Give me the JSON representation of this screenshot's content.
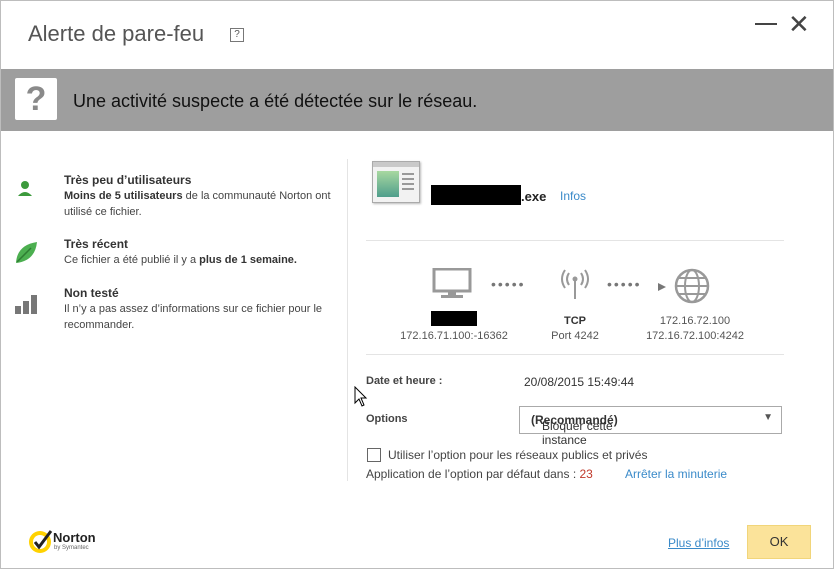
{
  "window": {
    "title": "Alerte de pare-feu",
    "help_glyph": "?",
    "close_glyph": "✕"
  },
  "banner": {
    "icon_glyph": "?",
    "message": "Une activité suspecte a été détectée sur le réseau."
  },
  "details": {
    "users": {
      "title": "Très peu d’utilisateurs",
      "text_bold": "Moins de 5 utilisateurs",
      "text_rest": " de la communauté Norton ont utilisé ce fichier."
    },
    "recent": {
      "title": "Très récent",
      "text_pre": "Ce fichier a été publié il y a ",
      "text_bold": "plus de 1 semaine."
    },
    "tested": {
      "title": "Non testé",
      "text": "Il n’y a pas assez d’informations sur ce fichier pour le recommander."
    }
  },
  "file": {
    "extension": ".exe",
    "info_link": "Infos"
  },
  "connection": {
    "local_address": "172.16.71.100:-16362",
    "protocol": "TCP",
    "port": "Port 4242",
    "remote_ip": "172.16.72.100",
    "remote_address": "172.16.72.100:4242",
    "dots_left": "•••••",
    "dots_right": "•••••"
  },
  "fields": {
    "datetime_label": "Date et heure :",
    "datetime_value": "20/08/2015 15:49:44",
    "options_label": "Options",
    "options_selected": "Bloquer cette instance",
    "options_selected_bold": "(Recommandé)",
    "options_caret": "▼"
  },
  "footer_options": {
    "checkbox_label": "Utiliser l’option pour les réseaux publics et privés",
    "timer_text": "Application de l’option par défaut dans : ",
    "timer_value": "23",
    "stop_link": "Arrêter la minuterie"
  },
  "footer": {
    "brand": "Norton",
    "brand_sub": "by Symantec",
    "more_link": "Plus d’infos",
    "ok_label": "OK"
  },
  "colors": {
    "banner": "#9e9e9e",
    "link": "#3a8ac9",
    "ok_button": "#fbe39a",
    "green": "#3c9a3c"
  }
}
